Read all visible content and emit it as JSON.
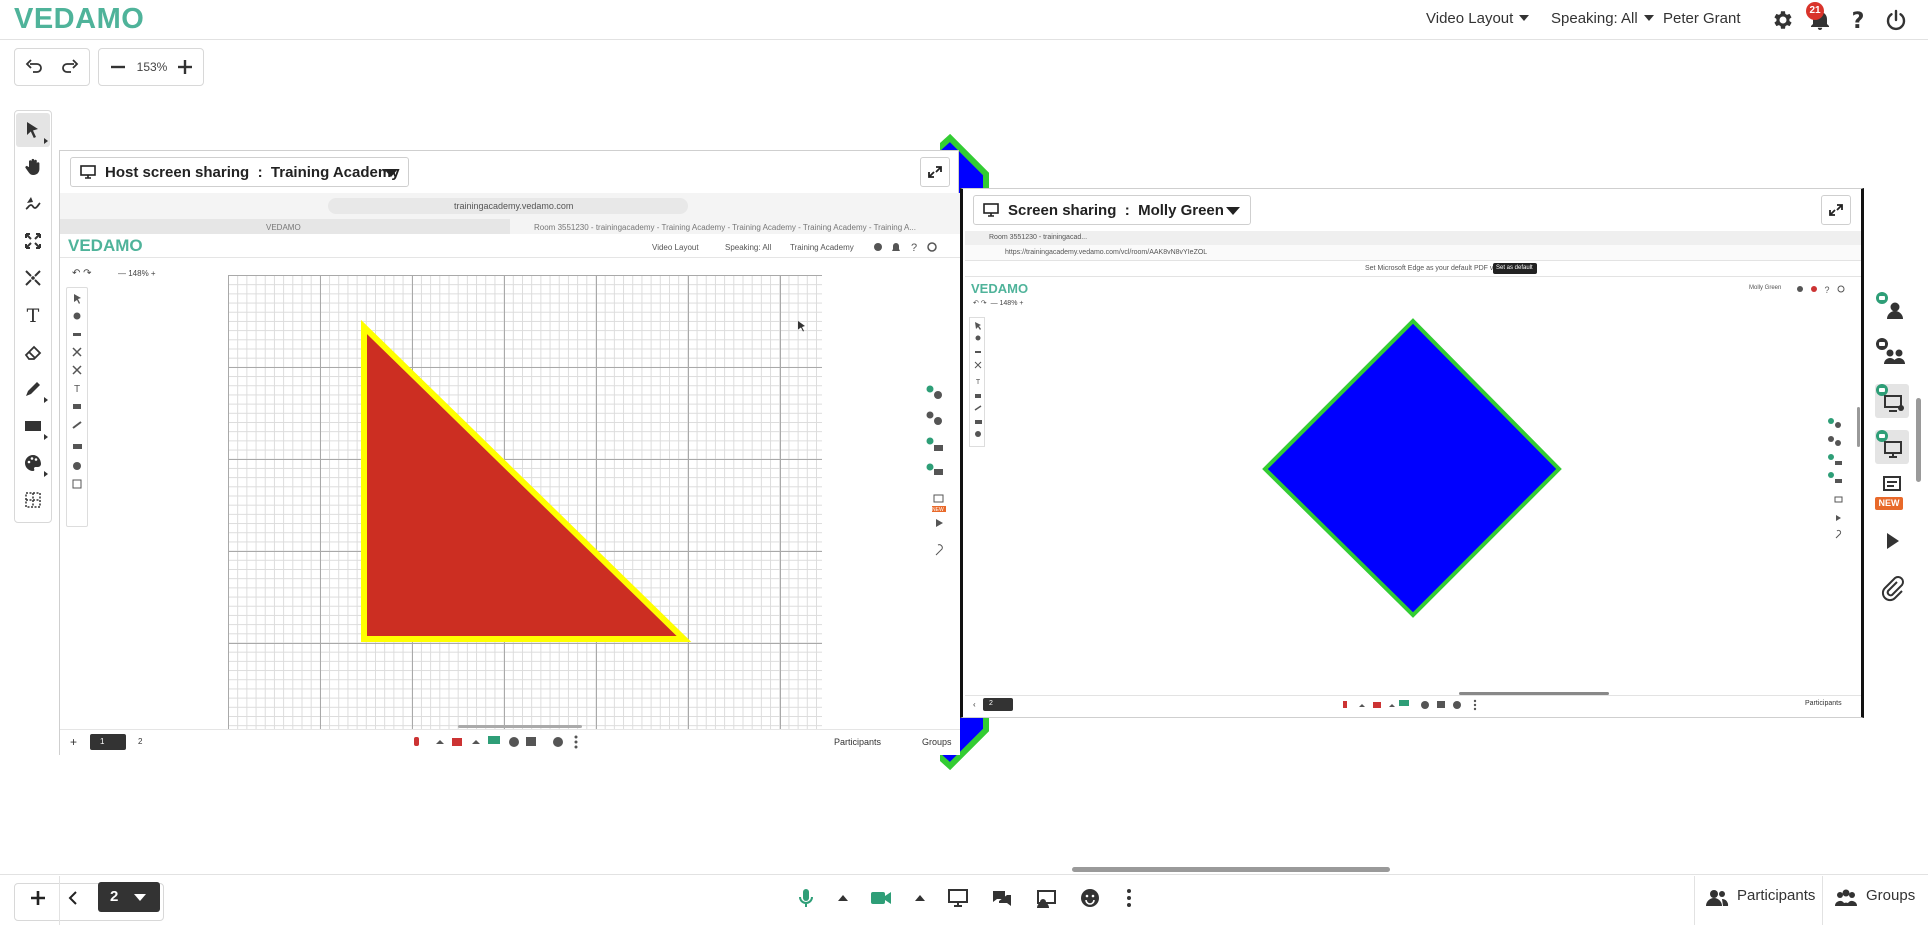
{
  "header": {
    "logo": "VEDAMO",
    "video_layout": "Video Layout",
    "speaking": "Speaking: All",
    "user_name": "Peter Grant",
    "notification_count": "21"
  },
  "toolbar": {
    "zoom_value": "153%"
  },
  "host_share": {
    "title": "Host screen sharing",
    "separator": ":",
    "name": "Training Academy",
    "inner": {
      "url": "trainingacademy.vedamo.com",
      "tab1": "VEDAMO",
      "tab2": "Room 3551230 - trainingacademy - Training Academy - Training Academy - Training Academy - Training A...",
      "logo": "VEDAMO",
      "video_layout": "Video Layout",
      "speaking": "Speaking: All",
      "user": "Training Academy",
      "zoom": "148%",
      "page_current": "1",
      "page_other": "2",
      "participants": "Participants",
      "groups": "Groups",
      "new_tag": "NEW"
    }
  },
  "molly_share": {
    "title": "Screen sharing",
    "separator": ":",
    "name": "Molly Green",
    "inner": {
      "tab": "Room 3551230 - trainingacad...",
      "url": "https://trainingacademy.vedamo.com/vcl/room/AAK8vN8vYIeZOL",
      "edge_notice": "Set Microsoft Edge as your default PDF viewer",
      "set_default": "Set as default",
      "logo": "VEDAMO",
      "user": "Molly Green",
      "zoom": "148%",
      "page": "2",
      "participants": "Participants"
    }
  },
  "right_panel": {
    "new_tag": "NEW"
  },
  "bottom": {
    "page": "2",
    "participants": "Participants",
    "groups": "Groups"
  },
  "colors": {
    "brand": "#4fb39a",
    "triangle_fill": "#cc2e22",
    "triangle_stroke": "#ffff00",
    "diamond_fill": "#0000ff",
    "diamond_stroke": "#22cc22",
    "badge": "#d9342b",
    "accent_green": "#2e9e77"
  },
  "icons": [
    "undo-icon",
    "redo-icon",
    "zoom-out-icon",
    "zoom-in-icon",
    "select-icon",
    "hand-icon",
    "pointer-icon",
    "fit-icon",
    "expand-icon",
    "text-icon",
    "eraser-icon",
    "pen-icon",
    "shape-icon",
    "palette-icon",
    "grid-icon",
    "gear-icon",
    "bell-icon",
    "help-icon",
    "power-icon",
    "microphone-icon",
    "camera-icon",
    "screen-share-icon",
    "chat-icon",
    "emoji-icon",
    "more-icon",
    "participants-icon",
    "groups-icon"
  ]
}
